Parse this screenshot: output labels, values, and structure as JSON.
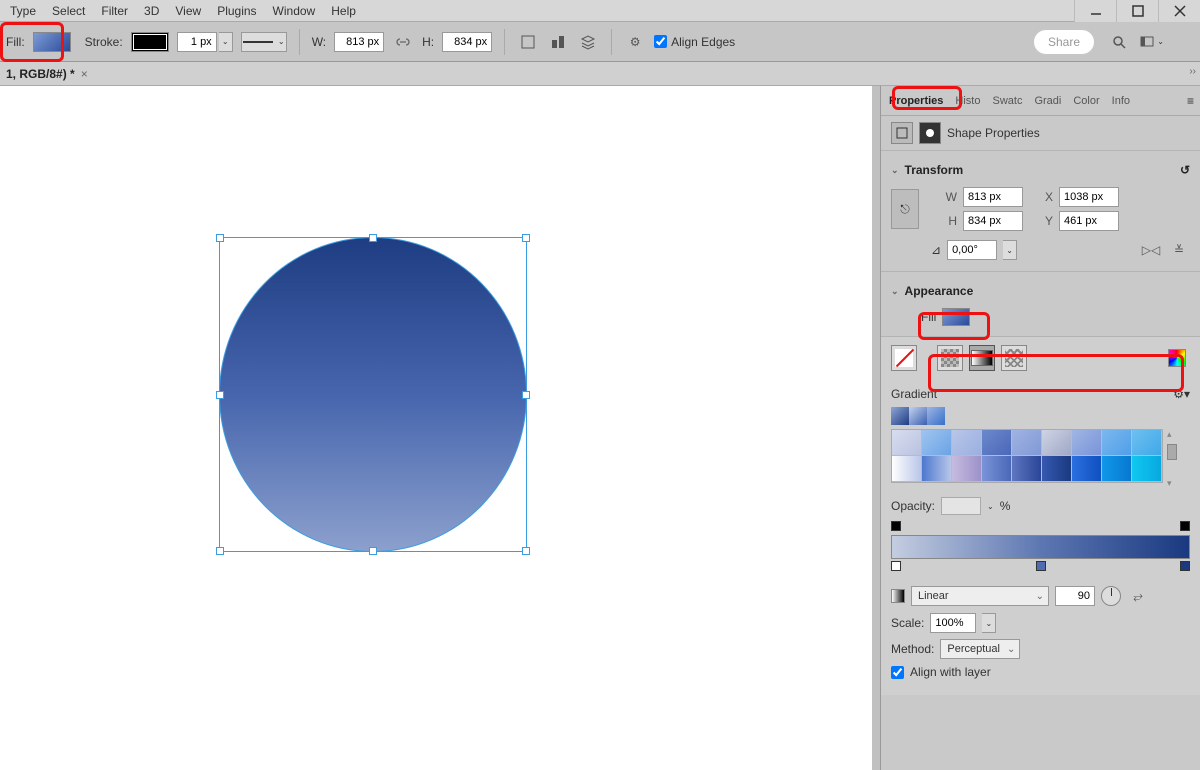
{
  "menubar": {
    "items": [
      "Type",
      "Select",
      "Filter",
      "3D",
      "View",
      "Plugins",
      "Window",
      "Help"
    ]
  },
  "optionsbar": {
    "fill_label": "Fill:",
    "stroke_label": "Stroke:",
    "stroke_width": "1 px",
    "w_label": "W:",
    "w_value": "813 px",
    "h_label": "H:",
    "h_value": "834 px",
    "align_edges": "Align Edges",
    "share": "Share"
  },
  "docbar": {
    "title": "1, RGB/8#) *"
  },
  "panels": {
    "tabs": [
      "Properties",
      "Histo",
      "Swatc",
      "Gradi",
      "Color",
      "Info"
    ],
    "active_tab": "Properties",
    "shape_properties": "Shape Properties",
    "transform": {
      "title": "Transform",
      "W": "813 px",
      "X": "1038 px",
      "H": "834 px",
      "Y": "461 px",
      "angle": "0,00°"
    },
    "appearance": {
      "title": "Appearance",
      "fill_label": "Fill"
    },
    "gradient": {
      "title": "Gradient",
      "opacity_label": "Opacity:",
      "opacity_unit": "%",
      "type_label": "Linear",
      "angle": "90",
      "scale_label": "Scale:",
      "scale_value": "100%",
      "method_label": "Method:",
      "method_value": "Perceptual",
      "align_layer": "Align with layer"
    }
  }
}
